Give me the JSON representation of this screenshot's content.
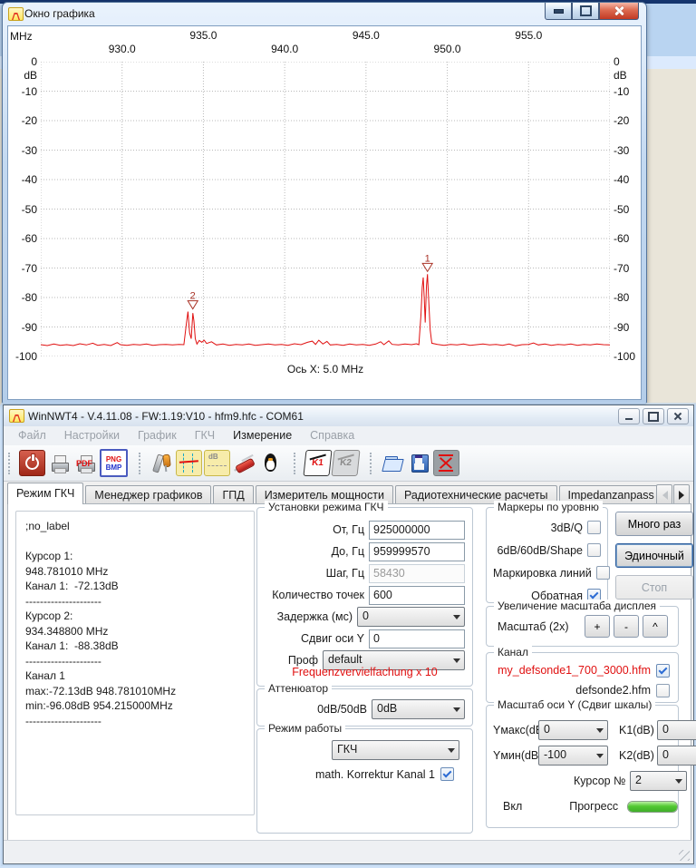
{
  "colors": {
    "trace_red": "#e01010",
    "marker_red": "#a93226",
    "note_red": "#e01010",
    "progress_green": "#3fae2a",
    "grid_gray": "#b9b9b9"
  },
  "graph_window": {
    "title": "Окно графика",
    "controls": [
      "minimize",
      "maximize",
      "close"
    ],
    "axis": {
      "x_unit_label": "MHz",
      "y_unit_label": "dB",
      "x_note": "Ось X: 5.0 MHz"
    },
    "chart_data": {
      "type": "line",
      "title": "Окно графика",
      "xlim": [
        925,
        960
      ],
      "ylim": [
        -100,
        0
      ],
      "x_tick_step": 5,
      "y_tick_step": 10,
      "x_ticks": [
        930,
        935,
        940,
        945,
        950,
        955
      ],
      "y_ticks": [
        0,
        -10,
        -20,
        -30,
        -40,
        -50,
        -60,
        -70,
        -80,
        -90,
        -100
      ],
      "xlabel": "MHz",
      "ylabel": "dB",
      "grid": "dotted",
      "x_axis_note": "Ось X: 5.0 MHz",
      "markers": [
        {
          "label": "1",
          "mhz": 948.78101,
          "db": -72.13,
          "apex_db": -71.8
        },
        {
          "label": "2",
          "mhz": 934.3488,
          "db": -88.38,
          "apex_db": -84.5
        }
      ],
      "series": [
        {
          "name": "Канал 1",
          "color": "#e01010",
          "points": [
            [
              925.0,
              -96.0
            ],
            [
              925.4,
              -96.3
            ],
            [
              925.8,
              -95.8
            ],
            [
              926.2,
              -96.2
            ],
            [
              926.6,
              -96.0
            ],
            [
              927.0,
              -96.3
            ],
            [
              927.4,
              -95.7
            ],
            [
              927.8,
              -96.1
            ],
            [
              928.2,
              -95.5
            ],
            [
              928.5,
              -96.2
            ],
            [
              928.9,
              -95.9
            ],
            [
              929.3,
              -96.3
            ],
            [
              929.7,
              -95.3
            ],
            [
              929.9,
              -96.0
            ],
            [
              930.3,
              -96.2
            ],
            [
              930.7,
              -95.9
            ],
            [
              931.1,
              -96.1
            ],
            [
              931.5,
              -95.8
            ],
            [
              931.9,
              -96.2
            ],
            [
              932.3,
              -96.0
            ],
            [
              932.7,
              -95.9
            ],
            [
              933.1,
              -96.1
            ],
            [
              933.5,
              -95.9
            ],
            [
              933.8,
              -96.0
            ],
            [
              933.95,
              -89.0
            ],
            [
              934.05,
              -84.8
            ],
            [
              934.15,
              -92.0
            ],
            [
              934.25,
              -94.0
            ],
            [
              934.35,
              -85.3
            ],
            [
              934.42,
              -88.0
            ],
            [
              934.5,
              -94.0
            ],
            [
              934.6,
              -95.8
            ],
            [
              934.75,
              -94.6
            ],
            [
              934.9,
              -95.2
            ],
            [
              935.05,
              -94.5
            ],
            [
              935.2,
              -95.6
            ],
            [
              935.5,
              -95.0
            ],
            [
              935.8,
              -96.1
            ],
            [
              936.2,
              -95.8
            ],
            [
              936.6,
              -96.2
            ],
            [
              937.0,
              -95.9
            ],
            [
              937.4,
              -96.1
            ],
            [
              937.8,
              -95.8
            ],
            [
              938.2,
              -96.2
            ],
            [
              938.6,
              -96.0
            ],
            [
              939.0,
              -95.8
            ],
            [
              939.4,
              -96.1
            ],
            [
              939.8,
              -95.9
            ],
            [
              940.2,
              -96.2
            ],
            [
              940.6,
              -95.7
            ],
            [
              941.0,
              -96.0
            ],
            [
              941.4,
              -95.2
            ],
            [
              941.7,
              -94.8
            ],
            [
              941.9,
              -95.9
            ],
            [
              942.1,
              -94.5
            ],
            [
              942.35,
              -95.8
            ],
            [
              942.6,
              -94.9
            ],
            [
              942.8,
              -96.1
            ],
            [
              943.2,
              -95.9
            ],
            [
              943.6,
              -96.2
            ],
            [
              944.0,
              -95.8
            ],
            [
              944.4,
              -96.1
            ],
            [
              944.8,
              -95.9
            ],
            [
              945.2,
              -96.2
            ],
            [
              945.6,
              -95.8
            ],
            [
              945.9,
              -95.0
            ],
            [
              946.1,
              -96.0
            ],
            [
              946.4,
              -94.7
            ],
            [
              946.6,
              -95.9
            ],
            [
              947.0,
              -96.1
            ],
            [
              947.4,
              -95.8
            ],
            [
              947.8,
              -96.0
            ],
            [
              948.1,
              -95.7
            ],
            [
              948.25,
              -96.0
            ],
            [
              948.38,
              -86.0
            ],
            [
              948.46,
              -76.5
            ],
            [
              948.52,
              -73.2
            ],
            [
              948.58,
              -80.0
            ],
            [
              948.64,
              -88.5
            ],
            [
              948.72,
              -76.0
            ],
            [
              948.78,
              -72.1
            ],
            [
              948.85,
              -80.0
            ],
            [
              948.95,
              -91.0
            ],
            [
              949.05,
              -95.5
            ],
            [
              949.4,
              -95.9
            ],
            [
              949.8,
              -96.2
            ],
            [
              950.2,
              -95.9
            ],
            [
              950.6,
              -96.1
            ],
            [
              951.0,
              -95.8
            ],
            [
              951.4,
              -96.2
            ],
            [
              951.8,
              -96.0
            ],
            [
              952.2,
              -95.8
            ],
            [
              952.6,
              -96.1
            ],
            [
              953.0,
              -95.9
            ],
            [
              953.4,
              -96.2
            ],
            [
              953.8,
              -95.8
            ],
            [
              954.2,
              -96.4
            ],
            [
              954.6,
              -96.0
            ],
            [
              955.0,
              -95.9
            ],
            [
              955.3,
              -95.4
            ],
            [
              955.6,
              -96.1
            ],
            [
              956.0,
              -95.8
            ],
            [
              956.4,
              -96.2
            ],
            [
              956.8,
              -95.9
            ],
            [
              957.2,
              -96.1
            ],
            [
              957.6,
              -95.8
            ],
            [
              958.0,
              -96.2
            ],
            [
              958.4,
              -95.9
            ],
            [
              958.8,
              -96.1
            ],
            [
              959.2,
              -95.8
            ],
            [
              959.6,
              -96.0
            ],
            [
              960.0,
              -96.1
            ]
          ]
        }
      ]
    }
  },
  "main_window": {
    "title": "WinNWT4 - V.4.11.08 - FW:1.19:V10 - hfm9.hfc - COM61",
    "controls": [
      "minimize",
      "maximize",
      "close"
    ],
    "menu": [
      {
        "label": "Файл",
        "enabled": false
      },
      {
        "label": "Настройки",
        "enabled": false
      },
      {
        "label": "График",
        "enabled": false
      },
      {
        "label": "ГКЧ",
        "enabled": false
      },
      {
        "label": "Измерение",
        "enabled": true
      },
      {
        "label": "Справка",
        "enabled": false
      }
    ],
    "toolbar": {
      "groups": [
        [
          "power-icon",
          "printer-icon",
          "pdf-print-icon",
          "png-bmp-icon"
        ],
        [
          "tools-icon",
          "sweep-config-icon",
          "db-scale-icon",
          "knife-icon",
          "penguin-icon"
        ],
        [
          "k1-correction-icon",
          "k2-correction-icon"
        ],
        [
          "open-file-icon",
          "save-file-icon",
          "sweep-limits-icon"
        ]
      ]
    },
    "tabs": {
      "items": [
        {
          "label": "Режим ГКЧ",
          "active": true
        },
        {
          "label": "Менеджер графиков",
          "active": false
        },
        {
          "label": "ГПД",
          "active": false
        },
        {
          "label": "Измеритель мощности",
          "active": false
        },
        {
          "label": "Радиотехнические расчеты",
          "active": false
        },
        {
          "label": "Impedanzanpass",
          "active": false,
          "clipped": true
        }
      ],
      "scroll_icons": [
        "tab-scroll-left",
        "tab-scroll-right"
      ]
    },
    "info_panel": {
      "lines": [
        ";no_label",
        "",
        "Курсор 1:",
        "948.781010 MHz",
        "Канал 1:  -72.13dB",
        "---------------------",
        "Курсор 2:",
        "934.348800 MHz",
        "Канал 1:  -88.38dB",
        "---------------------",
        "Канал 1",
        "max:-72.13dB 948.781010MHz",
        "min:-96.08dB 954.215000MHz",
        "---------------------"
      ]
    },
    "sweep_settings": {
      "legend": "Установки режима ГКЧ",
      "rows": [
        {
          "label": "От, Гц",
          "value": "925000000",
          "type": "input"
        },
        {
          "label": "До, Гц",
          "value": "959999570",
          "type": "input"
        },
        {
          "label": "Шаг, Гц",
          "value": "58430",
          "type": "input",
          "disabled": true
        },
        {
          "label": "Количество точек",
          "value": "600",
          "type": "input"
        },
        {
          "label": "Задержка (мс)",
          "value": "0",
          "type": "select"
        },
        {
          "label": "Сдвиг оси Y",
          "value": "0",
          "type": "input"
        },
        {
          "label": "Проф",
          "value": "default",
          "type": "select",
          "wide": true
        }
      ],
      "note": "Frequenzvervielfachung x 10"
    },
    "attenuator": {
      "legend": "Аттенюатор",
      "label": "0dB/50dB",
      "value": "0dB"
    },
    "work_mode": {
      "legend": "Режим работы",
      "value": "ГКЧ",
      "checkbox_label": "math. Korrektur Kanal 1",
      "checked": true
    },
    "level_markers": {
      "legend": "Маркеры по уровню",
      "items": [
        {
          "label": "3dB/Q",
          "checked": false
        },
        {
          "label": "6dB/60dB/Shape",
          "checked": false
        },
        {
          "label": "Маркировка линий",
          "checked": false
        },
        {
          "label": "Обратная",
          "checked": true
        }
      ]
    },
    "action_buttons": [
      {
        "label": "Много раз",
        "state": "normal"
      },
      {
        "label": "Эдиночный",
        "state": "focused"
      },
      {
        "label": "Стоп",
        "state": "disabled"
      }
    ],
    "zoom_group": {
      "legend": "Увеличение масштаба дисплея",
      "label": "Масштаб (2x)",
      "buttons": [
        "+",
        "-",
        "^"
      ]
    },
    "channel_group": {
      "legend": "Канал",
      "items": [
        {
          "label": "my_defsonde1_700_3000.hfm",
          "checked": true,
          "red": true
        },
        {
          "label": "defsonde2.hfm",
          "checked": false,
          "red": false
        }
      ]
    },
    "y_scale_group": {
      "legend": "Масштаб оси Y (Сдвиг шкалы)",
      "ymax_label": "Yмакс(dB",
      "ymax_value": "0",
      "k1_label": "K1(dB)",
      "k1_value": "0",
      "ymin_label": "Yмин(dB",
      "ymin_value": "-100",
      "k2_label": "K2(dB)",
      "k2_value": "0",
      "cursor_label": "Курсор №",
      "cursor_value": "2",
      "on_label": "Вкл",
      "progress_label": "Прогресс"
    }
  }
}
